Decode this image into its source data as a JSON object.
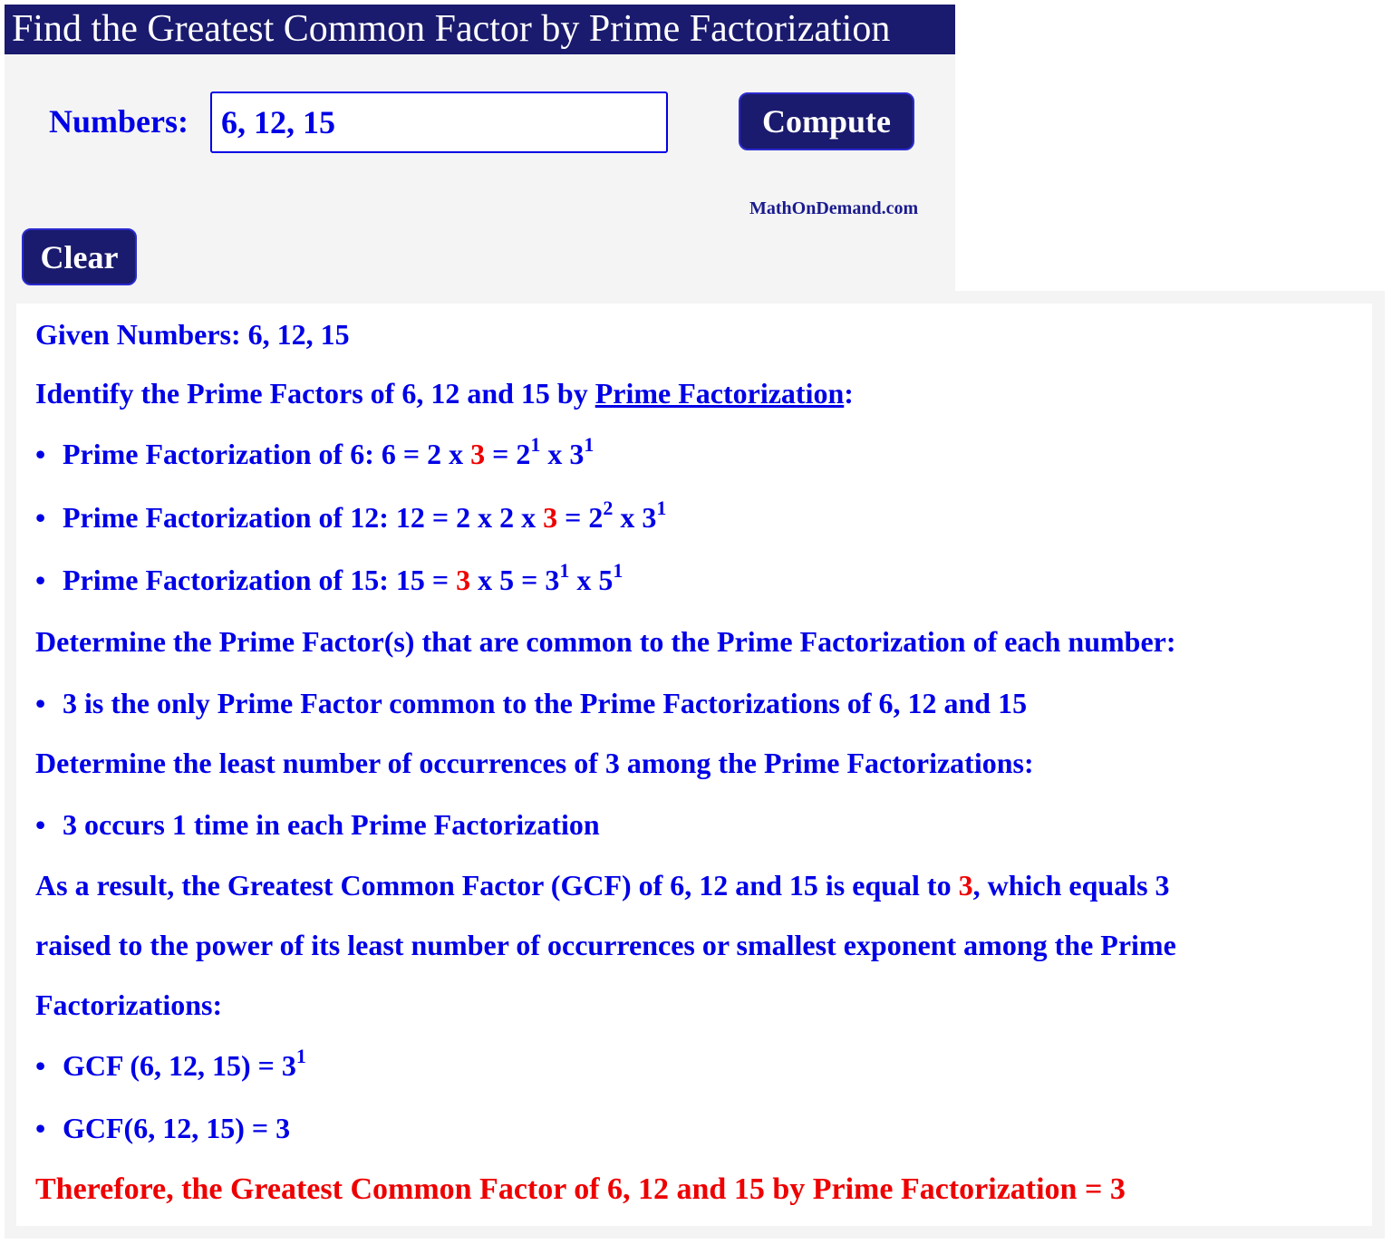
{
  "header": {
    "title": "Find the Greatest Common Factor by Prime Factorization"
  },
  "form": {
    "numbers_label": "Numbers:",
    "numbers_value": "6, 12, 15",
    "compute_label": "Compute",
    "clear_label": "Clear",
    "brand": "MathOnDemand.com"
  },
  "result": {
    "given": "Given Numbers: 6, 12, 15",
    "identify_prefix": "Identify the Prime Factors of 6, 12 and 15 by ",
    "identify_link": "Prime Factorization",
    "identify_suffix": ":",
    "factorizations": [
      {
        "prefix": "Prime Factorization of 6: 6 = 2 x ",
        "highlight": "3",
        "middle": " = 2",
        "exp1": "1",
        "mid2": " x 3",
        "exp2": "1"
      },
      {
        "prefix": "Prime Factorization of 12: 12 = 2 x 2 x ",
        "highlight": "3",
        "middle": " = 2",
        "exp1": "2",
        "mid2": " x 3",
        "exp2": "1"
      },
      {
        "prefix": "Prime Factorization of 15: 15 = ",
        "highlight": "3",
        "middle": " x 5 = 3",
        "exp1": "1",
        "mid2": " x 5",
        "exp2": "1"
      }
    ],
    "determine_common": "Determine the Prime Factor(s) that are common to the Prime Factorization of each number:",
    "common_bullet": "3 is the only Prime Factor common to the Prime Factorizations of 6, 12 and 15",
    "determine_least": "Determine the least number of occurrences of 3 among the Prime Factorizations:",
    "least_bullet": "3 occurs 1 time in each Prime Factorization",
    "result_line1_prefix": "As a result, the Greatest Common Factor (GCF) of 6, 12 and 15 is equal to ",
    "result_line1_highlight": "3",
    "result_line1_suffix": ", which equals 3",
    "result_line2": "raised to the power of its least number of occurrences or smallest exponent among the Prime",
    "result_line3": "Factorizations:",
    "gcf_exp_base": "GCF (6, 12, 15) = 3",
    "gcf_exp_power": "1",
    "gcf_value": "GCF(6, 12, 15) = 3",
    "conclusion": "Therefore, the Greatest Common Factor of 6, 12 and 15 by Prime Factorization = 3"
  },
  "colors": {
    "primary": "#1a1a6e",
    "text": "#0000e6",
    "highlight": "#ee0000"
  }
}
